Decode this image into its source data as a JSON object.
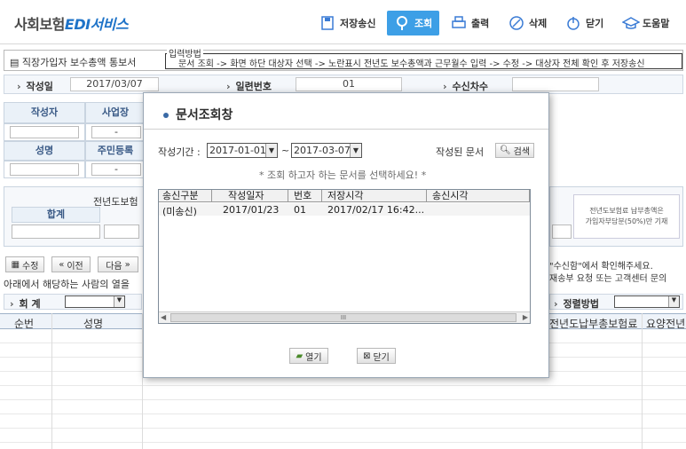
{
  "app": {
    "logo_main": "사회보험",
    "logo_accent": "EDI서비스"
  },
  "toolbar": {
    "save_send": "저장송신",
    "query": "조회",
    "print": "출력",
    "delete": "삭제",
    "close": "닫기",
    "help": "도움말"
  },
  "doc": {
    "title": "직장가입자 보수총액 통보서",
    "method_label": "입력방법",
    "method_text": "문서 조회 -> 화면 하단 대상자 선택 -> 노란표시 전년도 보수총액과 근무월수 입력 -> 수정 -> 대상자 전체 확인 후 저장송신"
  },
  "filters": {
    "date_label": "작성일",
    "date_value": "2017/03/07",
    "serial_label": "일련번호",
    "serial_value": "01",
    "receive_label": "수신차수",
    "receive_value": ""
  },
  "form": {
    "writer": "작성자",
    "business": "사업장",
    "name": "성명",
    "resident": "주민등록",
    "dash": "-",
    "prev_year": "전년도보험",
    "total": "합계",
    "note_line1": "전년도보험료 납부총액은",
    "note_line2": "가입자부담분(50%)만 기재"
  },
  "actions": {
    "edit": "수정",
    "prev": "이전",
    "next": "다음"
  },
  "notice": {
    "line1": "아래에서 해당하는 사람의 열을",
    "right1": "\"수신함\"에서 확인해주세요.",
    "right2": "재송부 요청 또는 고객센터 문의"
  },
  "accounting": {
    "label": "회 계",
    "sort_label": "정렬방법"
  },
  "list_columns": {
    "seq": "순번",
    "name": "성명",
    "prev_premium": "전년도납부총보험료",
    "care": "요양전년"
  },
  "dialog": {
    "title": "문서조회창",
    "period_label": "작성기간 :",
    "from": "2017-01-01",
    "to": "2017-03-07",
    "tilde": "~",
    "written_docs": "작성된 문서",
    "search": "검색",
    "note": "* 조회 하고자 하는 문서를 선택하세요! *",
    "columns": [
      "송신구분",
      "작성일자",
      "번호",
      "저장시각",
      "송신시각"
    ],
    "rows": [
      {
        "type": "(미송신)",
        "date": "2017/01/23",
        "no": "01",
        "saved": "2017/02/17 16:42...",
        "sent": ""
      }
    ],
    "scroll_mark": "III",
    "open": "열기",
    "close": "닫기"
  },
  "colors": {
    "accent": "#3d9fe6",
    "header_blue": "#1e73c8"
  }
}
